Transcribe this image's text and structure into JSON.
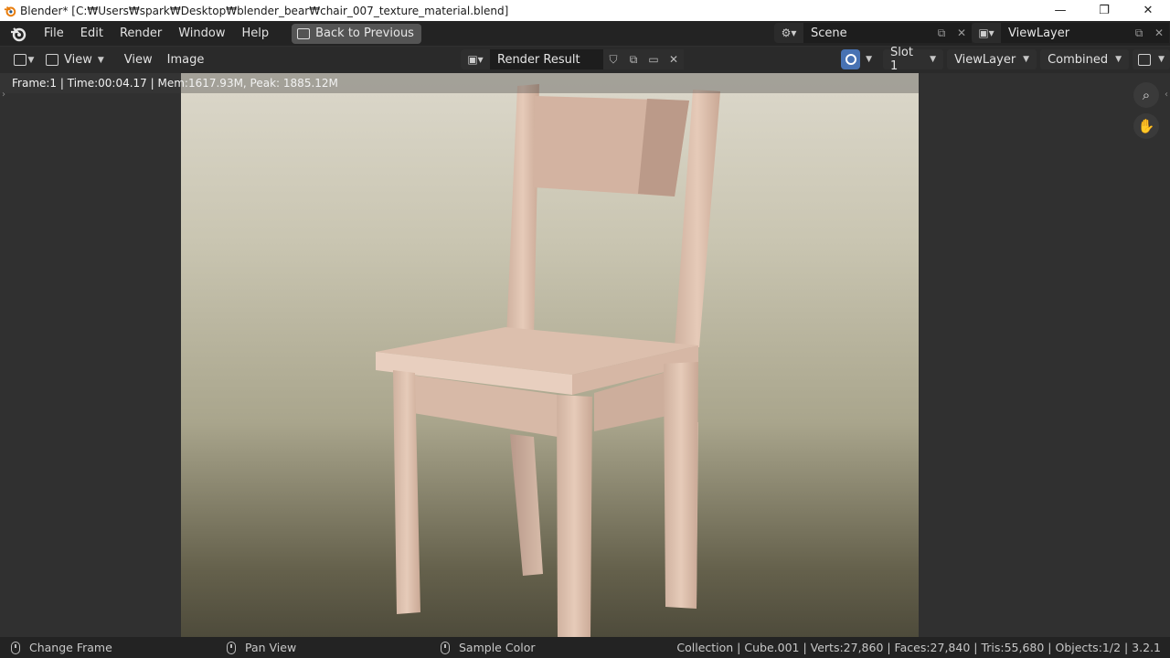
{
  "window": {
    "title": "Blender* [C:₩Users₩spark₩Desktop₩blender_bear₩chair_007_texture_material.blend]",
    "minimize": "—",
    "restore": "❐",
    "close": "✕"
  },
  "menubar": {
    "items": [
      "File",
      "Edit",
      "Render",
      "Window",
      "Help"
    ],
    "back_button": "Back to Previous",
    "scene": "Scene",
    "view_layer": "ViewLayer"
  },
  "editor_header": {
    "view_dropdown": "View",
    "menus": [
      "View",
      "Image"
    ],
    "image_name": "Render Result",
    "slot": "Slot 1",
    "layer": "ViewLayer",
    "pass": "Combined"
  },
  "viewport": {
    "render_info": "Frame:1 | Time:00:04.17 | Mem:1617.93M, Peak: 1885.12M"
  },
  "statusbar": {
    "left_action": "Change Frame",
    "middle_action": "Pan View",
    "right_action": "Sample Color",
    "stats": "Collection | Cube.001 | Verts:27,860 | Faces:27,840 | Tris:55,680 | Objects:1/2 | 3.2.1"
  },
  "colors": {
    "accent": "#4772b3",
    "background": "#303030",
    "header": "#232323"
  }
}
